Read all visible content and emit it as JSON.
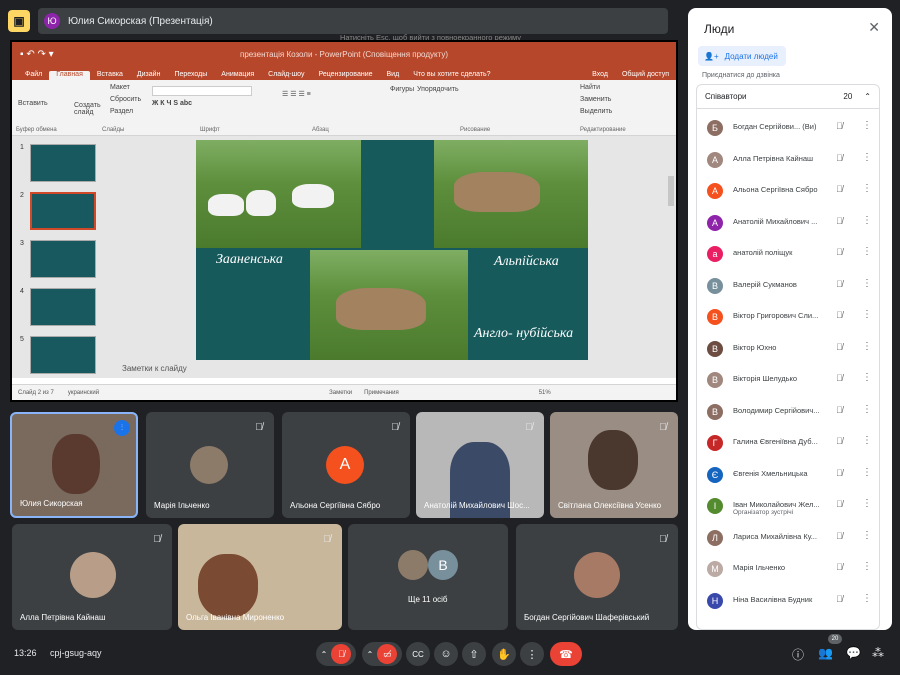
{
  "presenter": {
    "initial": "Ю",
    "label": "Юлия Сикорская (Презентація)"
  },
  "ppt": {
    "titlebar": "презентація Козоли - PowerPoint (Сповіщення продукту)",
    "menu": [
      "Файл",
      "Главная",
      "Вставка",
      "Дизайн",
      "Переходы",
      "Анимация",
      "Слайд-шоу",
      "Рецензирование",
      "Вид",
      "Что вы хотите сделать?"
    ],
    "login": "Вход",
    "share": "Общий доступ",
    "ribbon": {
      "paste": "Вставить",
      "create": "Создать слайд",
      "layout": "Макет",
      "reset": "Сбросить",
      "section": "Раздел",
      "clipboard": "Буфер обмена",
      "slides": "Слайды",
      "font": "Шрифт",
      "paragraph": "Абзац",
      "shapes": "Фигуры",
      "arrange": "Упорядочить",
      "drawing": "Рисование",
      "find": "Найти",
      "replace": "Заменить",
      "select": "Выделить",
      "editing": "Редактирование"
    },
    "thumb_numbers": [
      "1",
      "2",
      "3",
      "4",
      "5"
    ],
    "slide_labels": [
      "Зааненська",
      "Альпійська",
      "Англо- нубійська"
    ],
    "notes": "Заметки к слайду",
    "status_left": "Слайд 2 из 7",
    "status_lang": "украинский",
    "status_notes": "Заметки",
    "status_comments": "Примечания",
    "zoom": "51%"
  },
  "overlay_hint": "Натисніть Esc, щоб вийти з повноекранного режиму",
  "tiles": [
    {
      "name": "Юлия Сикорская"
    },
    {
      "name": "Марія Ільченко"
    },
    {
      "name": "Альона Сергіївна Сябро",
      "initial": "А"
    },
    {
      "name": "Анатолій Михайлович Шос..."
    },
    {
      "name": "Світлана Олексіївна Усенко"
    },
    {
      "name": "Алла Петрівна Кайнаш"
    },
    {
      "name": "Ольга Іванівна Мироненко"
    },
    {
      "name": "Ще 11 осіб",
      "initial": "В"
    },
    {
      "name": "Богдан Сергійович Шаферівський"
    }
  ],
  "panel": {
    "title": "Люди",
    "add_people": "Додати людей",
    "joined_hint": "Приєднатися до дзвінка",
    "section": "Співавтори",
    "count": "20",
    "people": [
      {
        "name": "Богдан Сергійови...  (Ви)",
        "initial": "Б",
        "color": "#8d6e63"
      },
      {
        "name": "Алла Петрівна Кайнаш",
        "initial": "А",
        "color": "#a1887f"
      },
      {
        "name": "Альона Сергіївна Сябро",
        "initial": "А",
        "color": "#f4511e"
      },
      {
        "name": "Анатолій Михайлович ...",
        "initial": "А",
        "color": "#8e24aa"
      },
      {
        "name": "анатолій поліщук",
        "initial": "а",
        "color": "#e91e63"
      },
      {
        "name": "Валерій Сукманов",
        "initial": "В",
        "color": "#78909c"
      },
      {
        "name": "Віктор Григорович Сли...",
        "initial": "В",
        "color": "#f4511e"
      },
      {
        "name": "Віктор Юхно",
        "initial": "В",
        "color": "#6d4c41"
      },
      {
        "name": "Вікторія Шелудько",
        "initial": "В",
        "color": "#a1887f"
      },
      {
        "name": "Володимир Сергійович...",
        "initial": "В",
        "color": "#8d6e63"
      },
      {
        "name": "Галина Євгеніївна Дуб...",
        "initial": "Г",
        "color": "#c62828"
      },
      {
        "name": "Євгенія Хмельницька",
        "initial": "Є",
        "color": "#1565c0"
      },
      {
        "name": "Іван Миколайович Жел...",
        "initial": "І",
        "color": "#558b2f",
        "sub": "Організатор зустрічі"
      },
      {
        "name": "Лариса Михайлівна Ку...",
        "initial": "Л",
        "color": "#8d6e63"
      },
      {
        "name": "Марія Ільченко",
        "initial": "М",
        "color": "#bcaaa4"
      },
      {
        "name": "Ніна Василівна Будник",
        "initial": "Н",
        "color": "#3949ab"
      }
    ]
  },
  "bottom": {
    "time": "13:26",
    "code": "cpj-gsug-aqy",
    "people_badge": "20"
  },
  "colors": {
    "accent": "#1a73e8",
    "end_call": "#ea4335",
    "ppt": "#b7472a"
  }
}
